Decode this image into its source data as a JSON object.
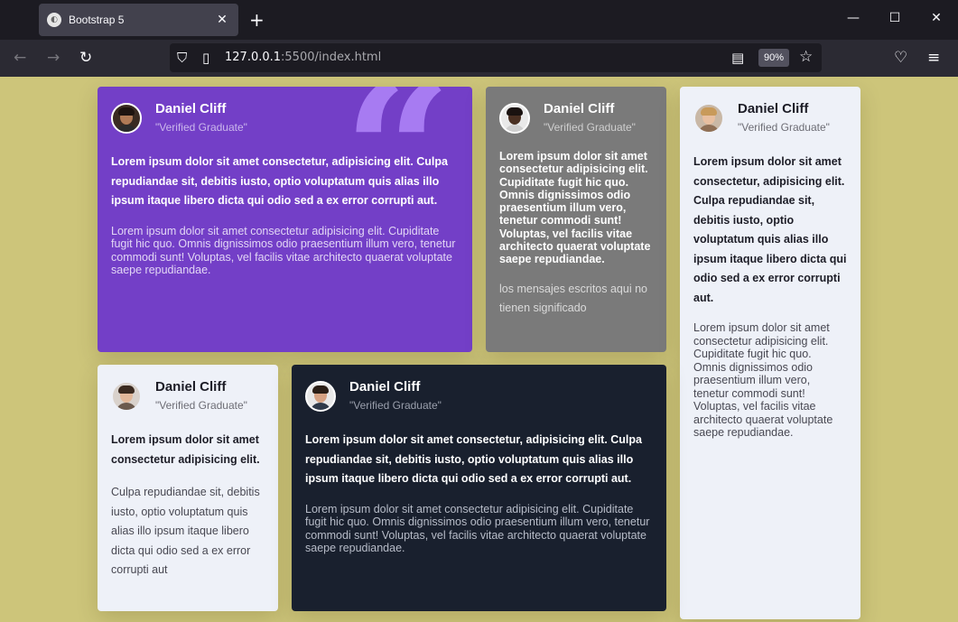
{
  "browser": {
    "tab_title": "Bootstrap 5",
    "url_host": "127.0.0.1",
    "url_rest": ":5500/index.html",
    "zoom": "90%"
  },
  "cards": [
    {
      "name": "Daniel Cliff",
      "role": "\"Verified Graduate\"",
      "lead": "Lorem ipsum dolor sit amet consectetur, adipisicing elit. Culpa repudiandae sit, debitis iusto, optio voluptatum quis alias illo ipsum itaque libero dicta qui odio sed a ex error corrupti aut.",
      "body": "Lorem ipsum dolor sit amet consectetur adipisicing elit. Cupiditate fugit hic quo. Omnis dignissimos odio praesentium illum vero, tenetur commodi sunt! Voluptas, vel facilis vitae architecto quaerat voluptate saepe repudiandae."
    },
    {
      "name": "Daniel Cliff",
      "role": "\"Verified Graduate\"",
      "lead": "Lorem ipsum dolor sit amet consectetur adipisicing elit. Cupiditate fugit hic quo. Omnis dignissimos odio praesentium illum vero, tenetur commodi sunt! Voluptas, vel facilis vitae architecto quaerat voluptate saepe repudiandae.",
      "body": "los mensajes escritos aqui no tienen significado"
    },
    {
      "name": "Daniel Cliff",
      "role": "\"Verified Graduate\"",
      "lead": "Lorem ipsum dolor sit amet consectetur, adipisicing elit. Culpa repudiandae sit, debitis iusto, optio voluptatum quis alias illo ipsum itaque libero dicta qui odio sed a ex error corrupti aut.",
      "body": "Lorem ipsum dolor sit amet consectetur adipisicing elit. Cupiditate fugit hic quo. Omnis dignissimos odio praesentium illum vero, tenetur commodi sunt! Voluptas, vel facilis vitae architecto quaerat voluptate saepe repudiandae."
    },
    {
      "name": "Daniel Cliff",
      "role": "\"Verified Graduate\"",
      "lead": "Lorem ipsum dolor sit amet consectetur adipisicing elit.",
      "body": "Culpa repudiandae sit, debitis iusto, optio voluptatum quis alias illo ipsum itaque libero dicta qui odio sed a ex error corrupti aut"
    },
    {
      "name": "Daniel Cliff",
      "role": "\"Verified Graduate\"",
      "lead": "Lorem ipsum dolor sit amet consectetur, adipisicing elit. Culpa repudiandae sit, debitis iusto, optio voluptatum quis alias illo ipsum itaque libero dicta qui odio sed a ex error corrupti aut.",
      "body": "Lorem ipsum dolor sit amet consectetur adipisicing elit. Cupiditate fugit hic quo. Omnis dignissimos odio praesentium illum vero, tenetur commodi sunt! Voluptas, vel facilis vitae architecto quaerat voluptate saepe repudiandae."
    }
  ],
  "colors": {
    "page_bg": "#cdc57a",
    "purple_card": "#733fc7",
    "gray_card": "#7a7a7a",
    "light_card": "#eef1f8",
    "dark_card": "#19202e"
  }
}
